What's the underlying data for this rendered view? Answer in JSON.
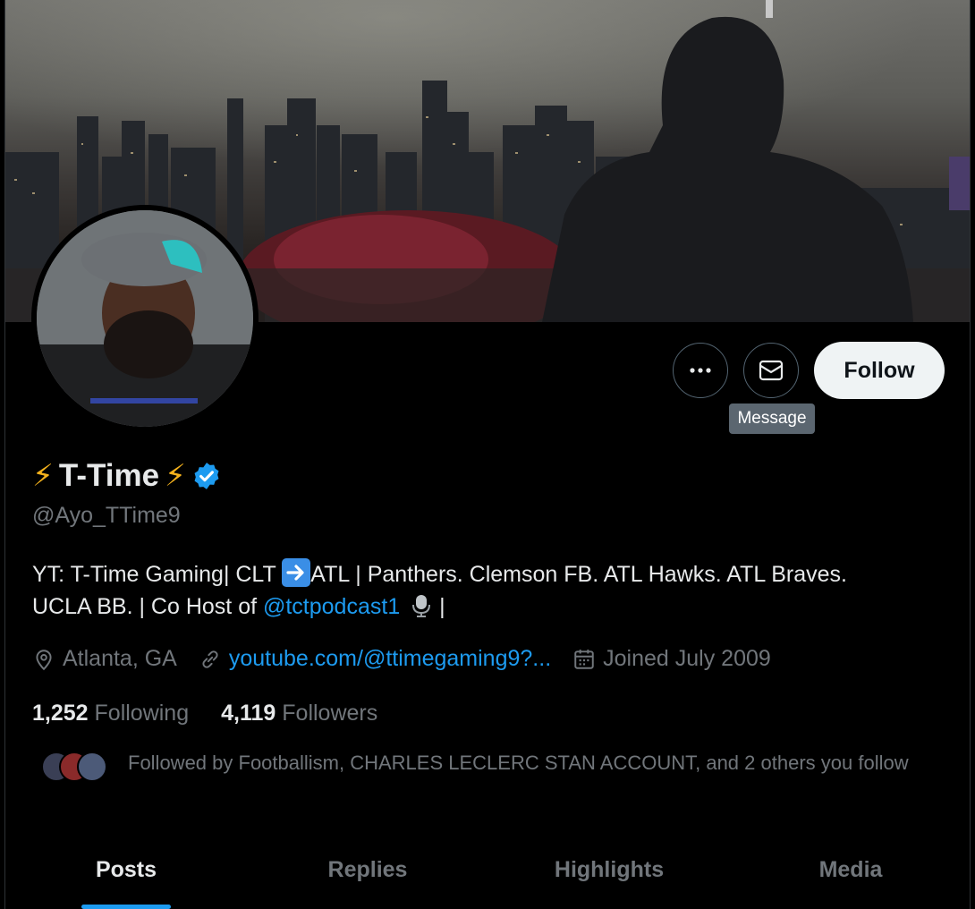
{
  "profile": {
    "name_text": "T-Time",
    "bolt_left": "⚡",
    "bolt_right": "⚡",
    "handle": "@Ayo_TTime9",
    "bio_part1": "YT: T-Time Gaming| CLT ",
    "bio_part2": "ATL | Panthers. Clemson FB. ATL Hawks. ATL Braves.",
    "bio_part3": "UCLA BB. | Co Host of ",
    "bio_mention": "@tctpodcast1",
    "bio_part4": " |",
    "location": "Atlanta, GA",
    "website": "youtube.com/@ttimegaming9?...",
    "joined": "Joined July 2009",
    "following_count": "1,252",
    "following_label": "Following",
    "followers_count": "4,119",
    "followers_label": "Followers",
    "followed_by": "Followed by Footballism, CHARLES LECLERC STAN ACCOUNT, and 2 others you follow"
  },
  "actions": {
    "follow_label": "Follow",
    "message_tooltip": "Message",
    "more_icon": "more-horizontal-icon",
    "message_icon": "envelope-icon"
  },
  "tabs": [
    {
      "label": "Posts",
      "active": true
    },
    {
      "label": "Replies",
      "active": false
    },
    {
      "label": "Highlights",
      "active": false
    },
    {
      "label": "Media",
      "active": false
    }
  ],
  "colors": {
    "accent": "#1d9bf0",
    "background": "#000000",
    "text": "#e7e9ea",
    "muted": "#71767b",
    "bolt": "#f5b21c"
  }
}
